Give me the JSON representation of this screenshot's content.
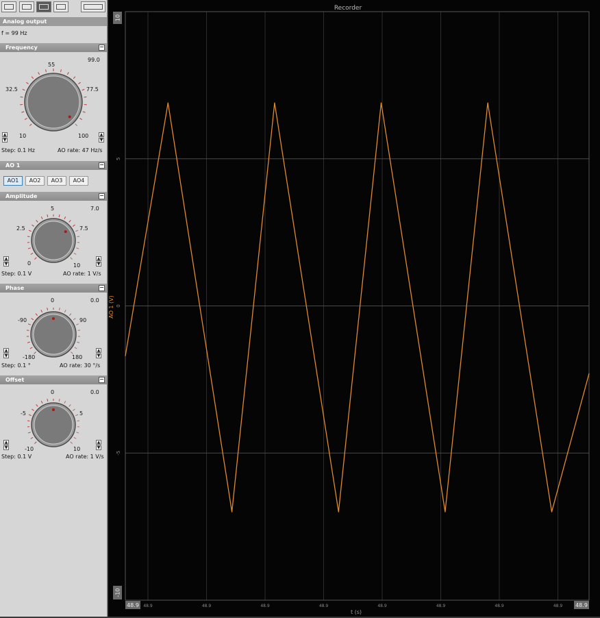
{
  "toolbar": {
    "icons": [
      "meter-icon",
      "recorder-icon",
      "generator-icon",
      "scope-icon",
      "device-icon"
    ]
  },
  "panel": {
    "title": "Analog output",
    "freq_readout": "f = 99 Hz",
    "frequency": {
      "title": "Frequency",
      "value": "99.0",
      "labels": {
        "top": "55",
        "left": "32.5",
        "right": "77.5",
        "min": "10",
        "max": "100"
      },
      "step": "Step: 0.1 Hz",
      "rate": "AO rate: 47 Hz/s",
      "level": 0.99
    },
    "ao_section": {
      "title": "AO 1",
      "tabs": [
        "AO1",
        "AO2",
        "AO3",
        "AO4"
      ],
      "selected": "AO1"
    },
    "amplitude": {
      "title": "Amplitude",
      "value": "7.0",
      "labels": {
        "top": "5",
        "left": "2.5",
        "right": "7.5",
        "min": "0",
        "max": "10"
      },
      "step": "Step: 0.1 V",
      "rate": "AO rate: 1 V/s",
      "level": 0.7
    },
    "phase": {
      "title": "Phase",
      "value": "0.0",
      "labels": {
        "top": "0",
        "left": "-90",
        "right": "90",
        "min": "-180",
        "max": "180"
      },
      "step": "Step: 0.1 °",
      "rate": "AO rate: 30 °/s",
      "level": 0.5
    },
    "offset": {
      "title": "Offset",
      "value": "0.0",
      "labels": {
        "top": "0",
        "left": "-5",
        "right": "5",
        "min": "-10",
        "max": "10"
      },
      "step": "Step: 0.1 V",
      "rate": "AO rate: 1 V/s",
      "level": 0.5
    }
  },
  "recorder": {
    "title": "Recorder",
    "y_min_box": "-10",
    "y_max_box": "10",
    "x_left_box": "48.9",
    "x_right_box": "48.9",
    "x_tick_labels": [
      "48.9",
      "48.9",
      "48.9",
      "48.9",
      "48.9",
      "48.9",
      "48.9",
      "48.9"
    ]
  },
  "chart_data": {
    "type": "line",
    "title": "Recorder",
    "xlabel": "t (s)",
    "ylabel": "AO 1 (V)",
    "ylim": [
      -10,
      10
    ],
    "y_ticks": [
      10,
      5,
      0,
      -5,
      -10
    ],
    "grid": true,
    "series": [
      {
        "color": "#e08a2a",
        "x": [
          0,
          0.4,
          1.0,
          1.4,
          2.0,
          2.4,
          3.0,
          3.4,
          4.0,
          4.35
        ],
        "y": [
          -1.7,
          6.9,
          -7.0,
          6.9,
          -7.0,
          6.9,
          -7.0,
          6.9,
          -7.0,
          -2.3
        ]
      }
    ]
  }
}
